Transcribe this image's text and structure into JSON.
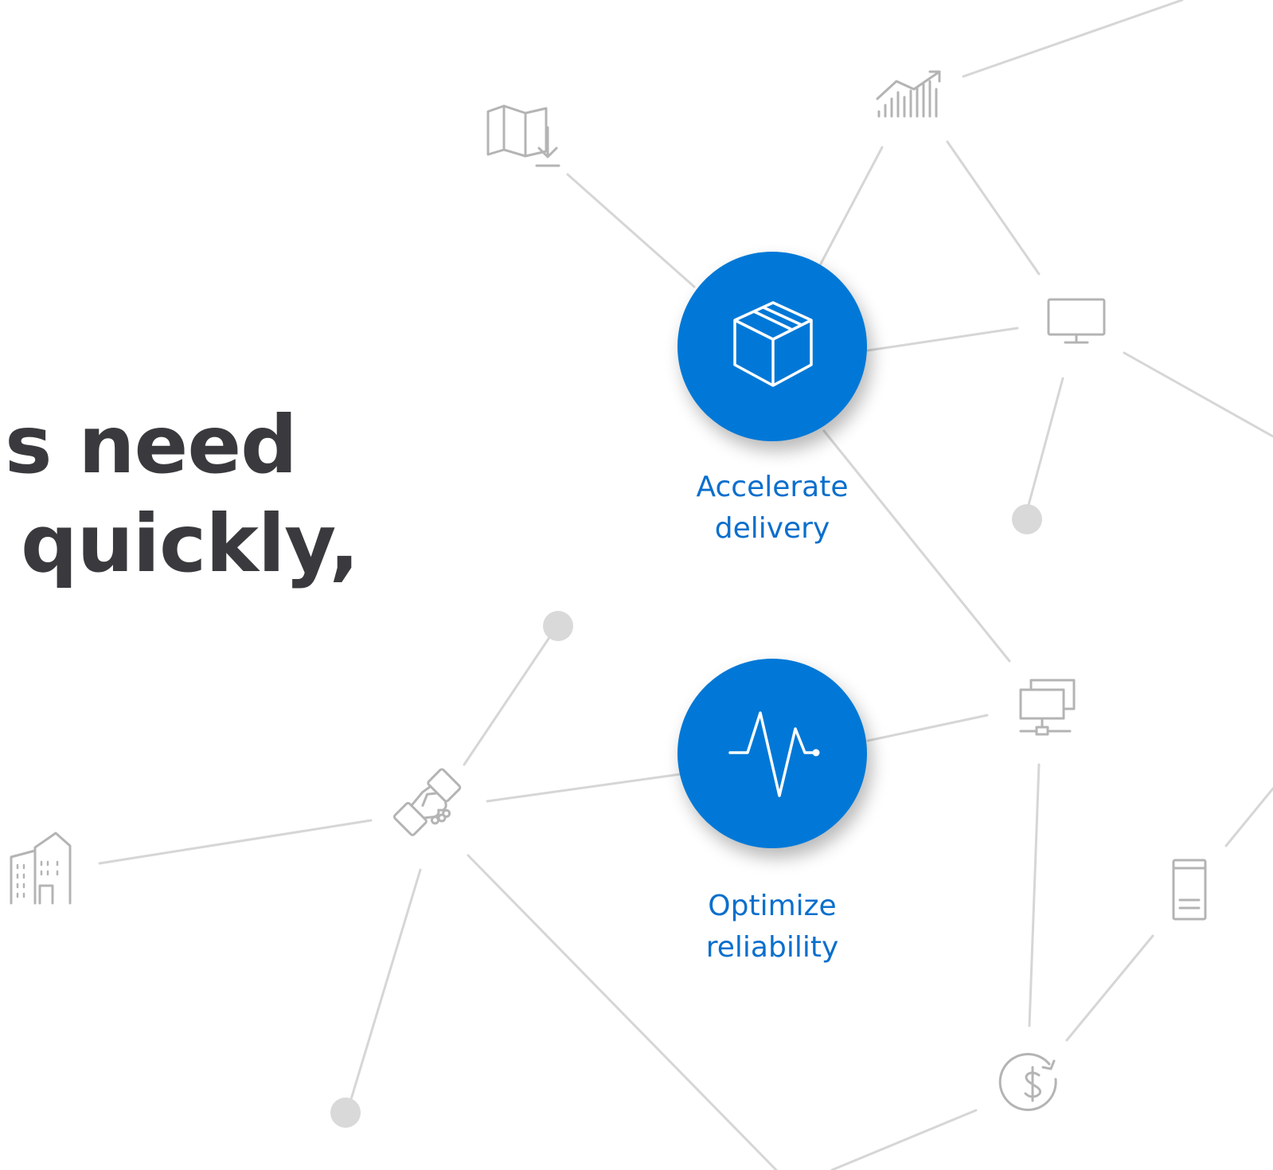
{
  "headline": {
    "line1": "s need",
    "line2": "quickly,"
  },
  "hubs": [
    {
      "id": "accelerate",
      "label_line1": "Accelerate",
      "label_line2": "delivery",
      "icon": "package-box-icon"
    },
    {
      "id": "optimize",
      "label_line1": "Optimize",
      "label_line2": "reliability",
      "icon": "heartbeat-pulse-icon"
    }
  ],
  "peripheral_icons": [
    "map-download-icon",
    "bar-chart-trend-icon",
    "monitor-icon",
    "networked-computers-icon",
    "handshake-icon",
    "office-building-icon",
    "server-tower-icon",
    "dollar-cycle-icon"
  ],
  "colors": {
    "hub_fill": "#0178d7",
    "hub_label": "#0a6fcd",
    "headline": "#3a3a3e",
    "line": "#d6d6d6",
    "icon_stroke": "#b4b4b4",
    "dot": "#d9d9d9"
  }
}
